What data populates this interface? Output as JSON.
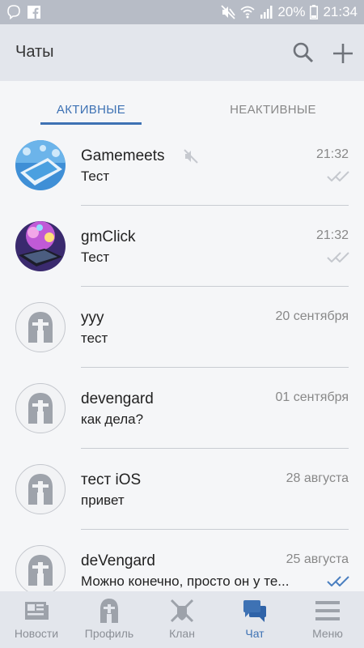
{
  "status_bar": {
    "battery": "20%",
    "time": "21:34"
  },
  "header": {
    "title": "Чаты"
  },
  "tabs": {
    "active": "АКТИВНЫЕ",
    "inactive": "НЕАКТИВНЫЕ"
  },
  "chats": [
    {
      "name": "Gamemeets",
      "message": "Тест",
      "time": "21:32",
      "avatar": "gamemeets-image",
      "muted": true,
      "read": true
    },
    {
      "name": "gmClick",
      "message": "Тест",
      "time": "21:32",
      "avatar": "gmclick-image",
      "muted": false,
      "read": true
    },
    {
      "name": "yyy",
      "message": "тест",
      "time": "20 сентября",
      "avatar": "default-helmet"
    },
    {
      "name": "devengard",
      "message": "как дела?",
      "time": "01 сентября",
      "avatar": "default-helmet"
    },
    {
      "name": "тест iOS",
      "message": "привет",
      "time": "28 августа",
      "avatar": "default-helmet"
    },
    {
      "name": "deVengard",
      "message": "Можно конечно, просто он у те...",
      "time": "25 августа",
      "avatar": "default-helmet",
      "read_highlight": true
    }
  ],
  "bottom_nav": [
    {
      "label": "Новости",
      "icon": "news-icon"
    },
    {
      "label": "Профиль",
      "icon": "profile-helmet-icon"
    },
    {
      "label": "Клан",
      "icon": "clan-swords-icon"
    },
    {
      "label": "Чат",
      "icon": "chat-icon",
      "active": true
    },
    {
      "label": "Меню",
      "icon": "menu-icon"
    }
  ],
  "colors": {
    "accent": "#3e72b4",
    "header_bg": "#e3e6ec",
    "status_bar_bg": "#b7bcc6"
  }
}
